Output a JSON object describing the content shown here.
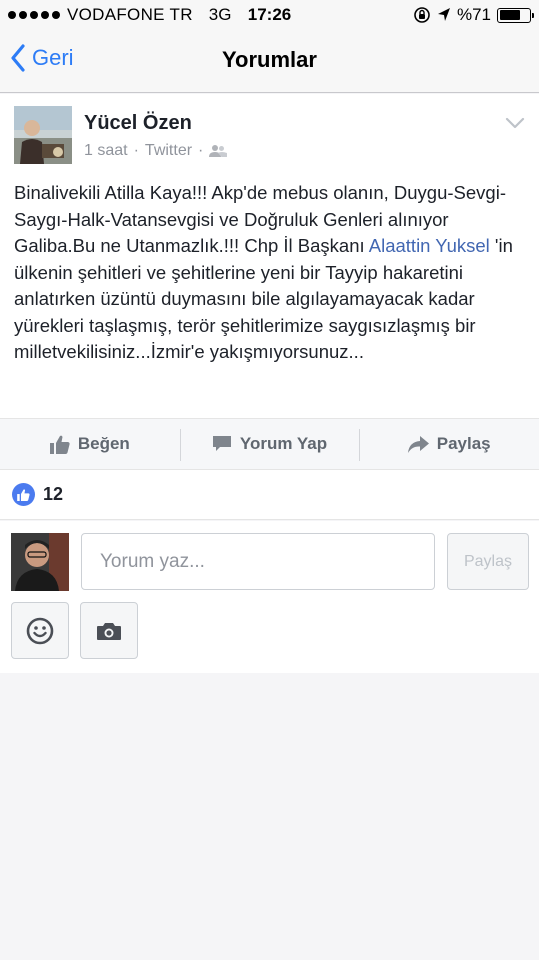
{
  "status_bar": {
    "carrier": "VODAFONE TR",
    "network": "3G",
    "time": "17:26",
    "battery_text": "%71",
    "battery_level": 0.71
  },
  "nav": {
    "back_label": "Geri",
    "title": "Yorumlar"
  },
  "post": {
    "author": "Yücel Özen",
    "time": "1 saat",
    "source": "Twitter",
    "separator": "·",
    "text_before": "Binalivekili Atilla Kaya!!! Akp'de mebus olanın, Duygu-Sevgi-Saygı-Halk-Vatansevgisi ve Doğruluk Genleri alınıyor Galiba.Bu ne Utanmazlık.!!! Chp İl Başkanı ",
    "mention": "Alaattin Yuksel",
    "text_after": " 'in ülkenin şehitleri ve şehitlerine yeni bir Tayyip hakaretini anlatırken üzüntü duymasını bile algılayamayacak kadar yürekleri taşlaşmış, terör şehitlerimize saygısızlaşmış bir milletvekilisiniz...İzmir'e yakışmıyorsunuz..."
  },
  "actions": {
    "like": "Beğen",
    "comment": "Yorum Yap",
    "share": "Paylaş"
  },
  "likes": {
    "count": "12"
  },
  "composer": {
    "placeholder": "Yorum yaz...",
    "share_label": "Paylaş"
  },
  "colors": {
    "accent": "#2d7cf6",
    "link": "#4267b2",
    "like_badge": "#4b7bef"
  }
}
